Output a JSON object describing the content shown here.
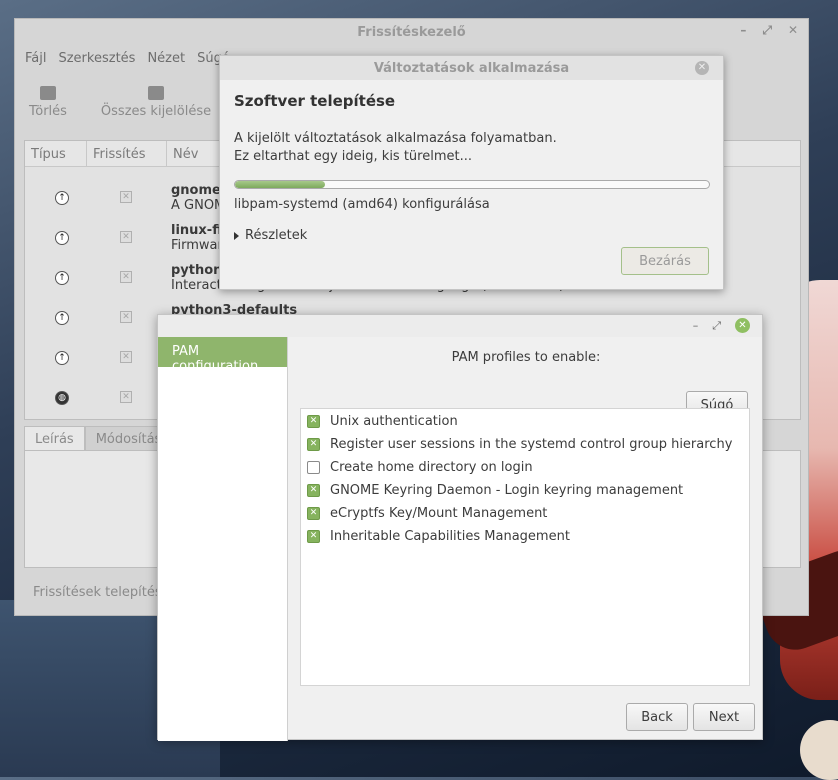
{
  "main_window": {
    "title": "Frissítéskezelő",
    "menu": [
      "Fájl",
      "Szerkesztés",
      "Nézet",
      "Súgó"
    ],
    "toolbar": [
      {
        "label": "Törlés",
        "icon": "clear-icon"
      },
      {
        "label": "Összes kijelölése",
        "icon": "select-all-icon"
      }
    ],
    "columns": [
      "Típus",
      "Frissítés",
      "Név"
    ],
    "rows": [
      {
        "type_icon": "arrow-up-icon",
        "name": "gnome-",
        "desc": "A GNOM"
      },
      {
        "type_icon": "arrow-up-icon",
        "name": "linux-fir",
        "desc": "Firmware"
      },
      {
        "type_icon": "arrow-up-icon",
        "name": "python3",
        "desc": "Interactive high-level object-oriented language (version 3.5)"
      },
      {
        "type_icon": "arrow-up-icon",
        "name": "python3-defaults",
        "desc": ""
      },
      {
        "type_icon": "arrow-up-icon",
        "name": "",
        "desc": ""
      },
      {
        "type_icon": "globe-icon",
        "name": "",
        "desc": ""
      }
    ],
    "tabs": [
      "Leírás",
      "Módosításo"
    ],
    "status": "Frissítések telepítése"
  },
  "apply_dialog": {
    "title": "Változtatások alkalmazása",
    "heading": "Szoftver telepítése",
    "line1": "A kijelölt változtatások alkalmazása folyamatban.",
    "line2": "Ez eltarthat egy ideig, kis türelmet...",
    "progress": 0.19,
    "status": "libpam-systemd (amd64) konfigurálása",
    "details_label": "Részletek",
    "close_label": "Bezárás"
  },
  "pam_window": {
    "sidebar_item": "PAM configuration",
    "heading": "PAM profiles to enable:",
    "help_label": "Súgó",
    "profiles": [
      {
        "label": "Unix authentication",
        "checked": true
      },
      {
        "label": "Register user sessions in the systemd control group hierarchy",
        "checked": true
      },
      {
        "label": "Create home directory on login",
        "checked": false
      },
      {
        "label": "GNOME Keyring Daemon - Login keyring management",
        "checked": true
      },
      {
        "label": "eCryptfs Key/Mount Management",
        "checked": true
      },
      {
        "label": "Inheritable Capabilities Management",
        "checked": true
      }
    ],
    "back_label": "Back",
    "next_label": "Next"
  }
}
